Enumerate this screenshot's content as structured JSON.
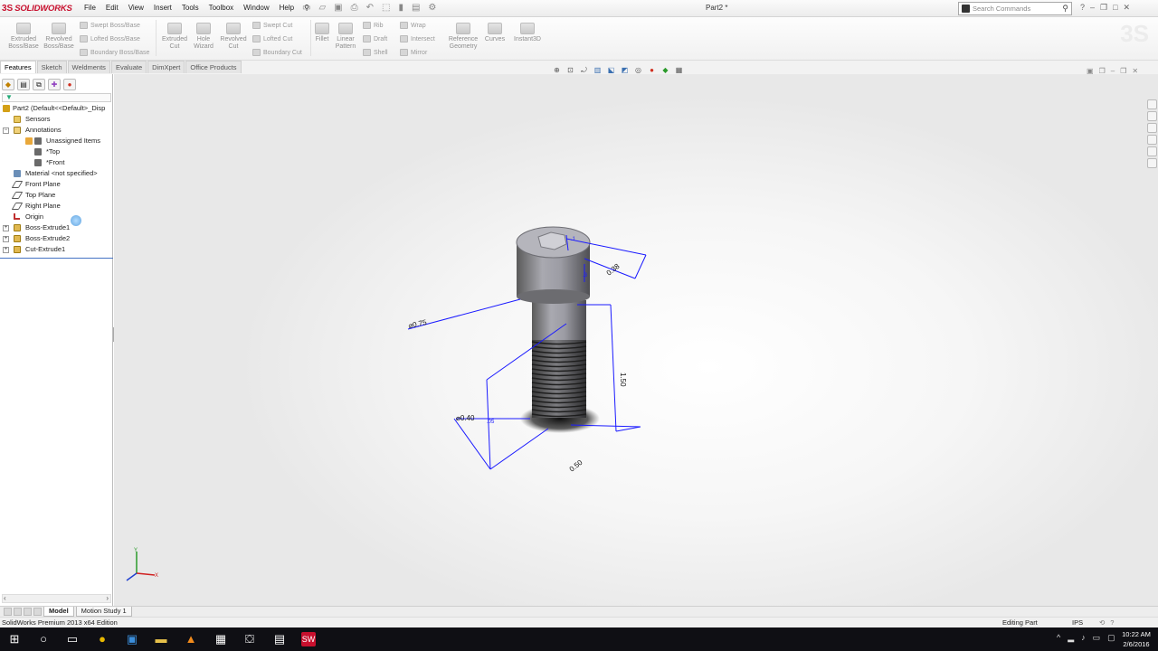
{
  "app": {
    "brand_ds": "3S",
    "brand_name": "SOLIDWORKS",
    "document_title": "Part2 *"
  },
  "menus": [
    "File",
    "Edit",
    "View",
    "Insert",
    "Tools",
    "Toolbox",
    "Window",
    "Help"
  ],
  "search": {
    "placeholder": "Search Commands"
  },
  "command_manager": {
    "extruded_boss": "Extruded Boss/Base",
    "revolved_boss": "Revolved Boss/Base",
    "swept_boss": "Swept Boss/Base",
    "lofted_boss": "Lofted Boss/Base",
    "boundary_boss": "Boundary Boss/Base",
    "extruded_cut": "Extruded Cut",
    "hole_wizard": "Hole Wizard",
    "revolved_cut": "Revolved Cut",
    "swept_cut": "Swept Cut",
    "lofted_cut": "Lofted Cut",
    "boundary_cut": "Boundary Cut",
    "fillet": "Fillet",
    "linear_pattern": "Linear Pattern",
    "rib": "Rib",
    "draft": "Draft",
    "shell": "Shell",
    "wrap": "Wrap",
    "intersect": "Intersect",
    "mirror": "Mirror",
    "reference_geometry": "Reference Geometry",
    "curves": "Curves",
    "instant3d": "Instant3D"
  },
  "tabs": [
    "Features",
    "Sketch",
    "Weldments",
    "Evaluate",
    "DimXpert",
    "Office Products"
  ],
  "active_tab": "Features",
  "tree": {
    "root": "Part2  (Default<<Default>_Disp",
    "items": [
      {
        "label": "Sensors"
      },
      {
        "label": "Annotations"
      },
      {
        "label": "Unassigned Items"
      },
      {
        "label": "*Top"
      },
      {
        "label": "*Front"
      },
      {
        "label": "Material <not specified>"
      },
      {
        "label": "Front Plane"
      },
      {
        "label": "Top Plane"
      },
      {
        "label": "Right Plane"
      },
      {
        "label": "Origin"
      },
      {
        "label": "Boss-Extrude1"
      },
      {
        "label": "Boss-Extrude2"
      },
      {
        "label": "Cut-Extrude1"
      }
    ]
  },
  "dimensions": {
    "head_dia": "⌀0.75",
    "head_height": "0.38",
    "shank_dia": "⌀0.40",
    "length": "1.50",
    "depth": "0.50",
    "hex_a": ".1",
    "hex_b": ".3",
    "small": ".05"
  },
  "bottom_tabs": [
    "Model",
    "Motion Study 1"
  ],
  "status": {
    "edition": "SolidWorks Premium 2013 x64 Edition",
    "mode": "Editing Part",
    "units": "IPS"
  },
  "clock": {
    "time": "10:22 AM",
    "date": "2/6/2016"
  },
  "colors": {
    "brand_red": "#c8102e",
    "dimension_blue": "#1a1aff",
    "tree_highlight": "#4472c4"
  }
}
